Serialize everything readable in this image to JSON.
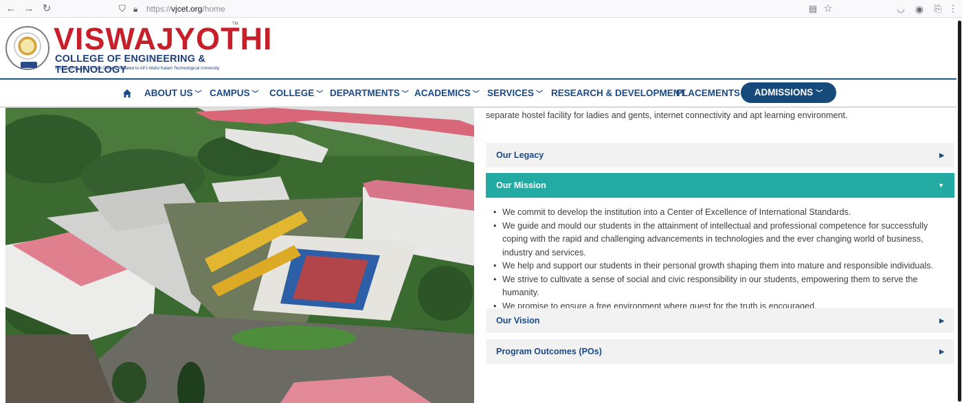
{
  "browser": {
    "url_prefix": "https://",
    "url_domain": "vjcet.org",
    "url_path": "/home",
    "icons": [
      "back-arrow-icon",
      "forward-arrow-icon",
      "reload-icon",
      "shield-icon",
      "lock-icon",
      "reader-view-icon",
      "bookmark-star-icon",
      "pocket-icon",
      "account-icon",
      "extensions-icon",
      "menu-icon"
    ]
  },
  "header": {
    "brand_name": "VISWAJYOTHI",
    "trademark": "TM",
    "subtitle": "COLLEGE OF ENGINEERING & TECHNOLOGY",
    "approval": "Approved by AICTE New Delhi & Affiliated to APJ Abdul Kalam Technological University",
    "colors": {
      "brand": "#c8202a",
      "navy": "#1f3f7a"
    }
  },
  "nav": {
    "items": [
      {
        "label": "ABOUT US",
        "has_dropdown": true
      },
      {
        "label": "CAMPUS",
        "has_dropdown": true
      },
      {
        "label": "COLLEGE",
        "has_dropdown": true
      },
      {
        "label": "DEPARTMENTS",
        "has_dropdown": true
      },
      {
        "label": "ACADEMICS",
        "has_dropdown": true
      },
      {
        "label": "SERVICES",
        "has_dropdown": true
      },
      {
        "label": "RESEARCH & DEVELOPMENT",
        "has_dropdown": false
      },
      {
        "label": "PLACEMENTS",
        "has_dropdown": false
      }
    ],
    "admissions_label": "ADMISSIONS",
    "colors": {
      "text": "#174a87",
      "button": "#154a7a"
    }
  },
  "content": {
    "intro": "separate hostel facility for ladies and gents, internet connectivity and apt learning environment.",
    "accordion": [
      {
        "title": "Our Legacy",
        "expanded": false
      },
      {
        "title": "Our Mission",
        "expanded": true
      },
      {
        "title": "Our Vision",
        "expanded": false
      },
      {
        "title": "Program Outcomes (POs)",
        "expanded": false
      }
    ],
    "mission_points": [
      "We commit to develop the institution into a Center of Excellence of International Standards.",
      "We guide and mould our students in the attainment of intellectual and professional competence for successfully coping with the rapid and challenging advancements in technologies and the ever changing world of business, industry and services.",
      "We help and support our students in their personal growth shaping them into mature and responsible individuals.",
      "We strive to cultivate a sense of social and civic responsibility in our students, empowering them to serve the humanity.",
      "We promise to ensure a free environment where quest for the truth is encouraged."
    ],
    "colors": {
      "active": "#23aaa3",
      "inactive": "#f2f2f2"
    }
  }
}
